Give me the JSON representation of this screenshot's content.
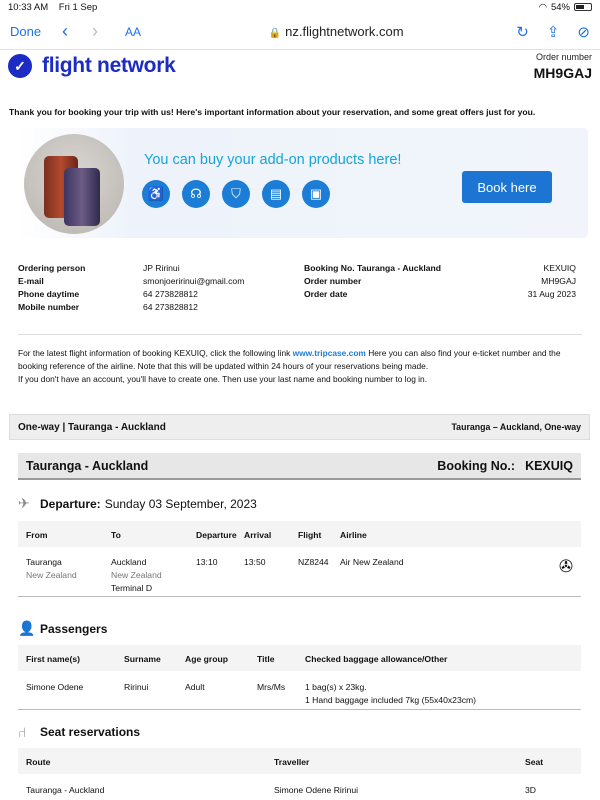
{
  "status_bar": {
    "time": "10:33 AM",
    "date": "Fri 1 Sep",
    "battery": "54%"
  },
  "browser": {
    "done_label": "Done",
    "aa_label": "AA",
    "url": "nz.flightnetwork.com"
  },
  "brand": {
    "name": "flight network",
    "order_number_label": "Order number",
    "order_number": "MH9GAJ"
  },
  "thanks_text": "Thank you for booking your trip with us! Here's important information about your reservation, and some great offers just for you.",
  "promo": {
    "title": "You can buy your add-on products here!",
    "button_label": "Book here",
    "icons": [
      "seat-icon",
      "headset-icon",
      "shield-icon",
      "document-icon",
      "baggage-icon"
    ]
  },
  "booking_info": {
    "left": [
      {
        "label": "Ordering person",
        "value": "JP Ririnui"
      },
      {
        "label": "E-mail",
        "value": "smonjoeririnui@gmail.com"
      },
      {
        "label": "Phone daytime",
        "value": "64 273828812"
      },
      {
        "label": "Mobile number",
        "value": "64 273828812"
      }
    ],
    "right": [
      {
        "label": "Booking No. Tauranga - Auckland",
        "value": "KEXUIQ"
      },
      {
        "label": "Order number",
        "value": "MH9GAJ"
      },
      {
        "label": "Order date",
        "value": "31 Aug 2023"
      }
    ]
  },
  "notice": {
    "part1": "For the latest flight information of booking KEXUIQ, click the following link ",
    "link": "www.tripcase.com",
    "part2": " Here you can also find your e-ticket number and the booking reference of the airline. Note that this will be updated within 24 hours of your reservations being made.",
    "line3": "If you don't have an account, you'll have to create one. Then use your last name and booking number to log in."
  },
  "trip_band": {
    "left": "One-way | Tauranga - Auckland",
    "right": "Tauranga – Auckland, One-way"
  },
  "route_bar": {
    "route": "Tauranga - Auckland",
    "booking_label": "Booking No.:",
    "booking_no": "KEXUIQ"
  },
  "departure": {
    "heading": "Departure:",
    "date": "Sunday 03 September, 2023",
    "columns": [
      "From",
      "To",
      "Departure",
      "Arrival",
      "Flight",
      "Airline"
    ],
    "row": {
      "from_city": "Tauranga",
      "from_country": "New Zealand",
      "to_city": "Auckland",
      "to_country": "New Zealand",
      "terminal": "Terminal D",
      "departure": "13:10",
      "arrival": "13:50",
      "flight": "NZ8244",
      "airline": "Air New Zealand"
    }
  },
  "passengers": {
    "heading": "Passengers",
    "columns": [
      "First name(s)",
      "Surname",
      "Age group",
      "Title",
      "Checked baggage allowance/Other"
    ],
    "row": {
      "first": "Simone Odene",
      "surname": "Ririnui",
      "age": "Adult",
      "title": "Mrs/Ms",
      "bag1": "1 bag(s) x 23kg.",
      "bag2": "1 Hand baggage included 7kg (55x40x23cm)"
    }
  },
  "seats": {
    "heading": "Seat reservations",
    "columns": [
      "Route",
      "Traveller",
      "Seat"
    ],
    "row": {
      "route": "Tauranga - Auckland",
      "traveller": "Simone Odene Ririnui",
      "seat": "3D"
    }
  }
}
